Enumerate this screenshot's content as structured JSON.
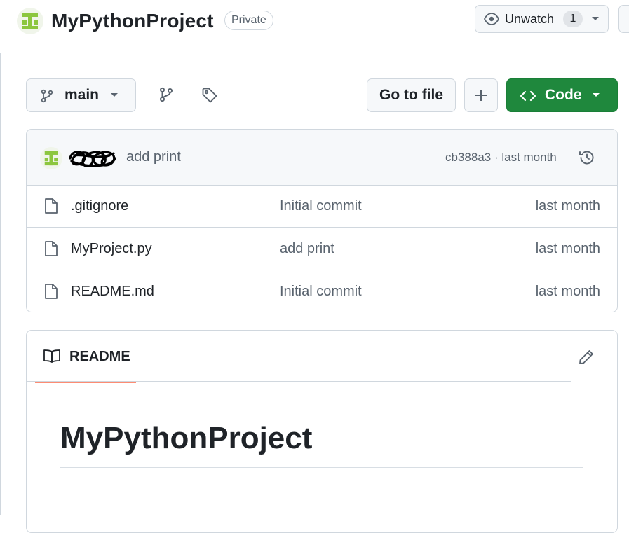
{
  "repo": {
    "name": "MyPythonProject",
    "visibility": "Private",
    "watch_label": "Unwatch",
    "watch_count": "1"
  },
  "toolbar": {
    "branch": "main",
    "goto_file": "Go to file",
    "code_label": "Code"
  },
  "latest_commit": {
    "message": "add print",
    "meta": "cb388a3 · last month"
  },
  "files": [
    {
      "name": ".gitignore",
      "message": "Initial commit",
      "date": "last month"
    },
    {
      "name": "MyProject.py",
      "message": "add print",
      "date": "last month"
    },
    {
      "name": "README.md",
      "message": "Initial commit",
      "date": "last month"
    }
  ],
  "readme": {
    "tab_label": "README",
    "heading": "MyPythonProject"
  },
  "colors": {
    "accent_green": "#1f883d",
    "tab_underline": "#fd8c73",
    "avatar_green": "#8cc63f"
  },
  "icons": [
    "repo-avatar-icon",
    "eye-icon",
    "branch-icon",
    "tag-icon",
    "plus-icon",
    "code-icon",
    "history-icon",
    "file-icon",
    "book-icon",
    "pencil-icon"
  ]
}
